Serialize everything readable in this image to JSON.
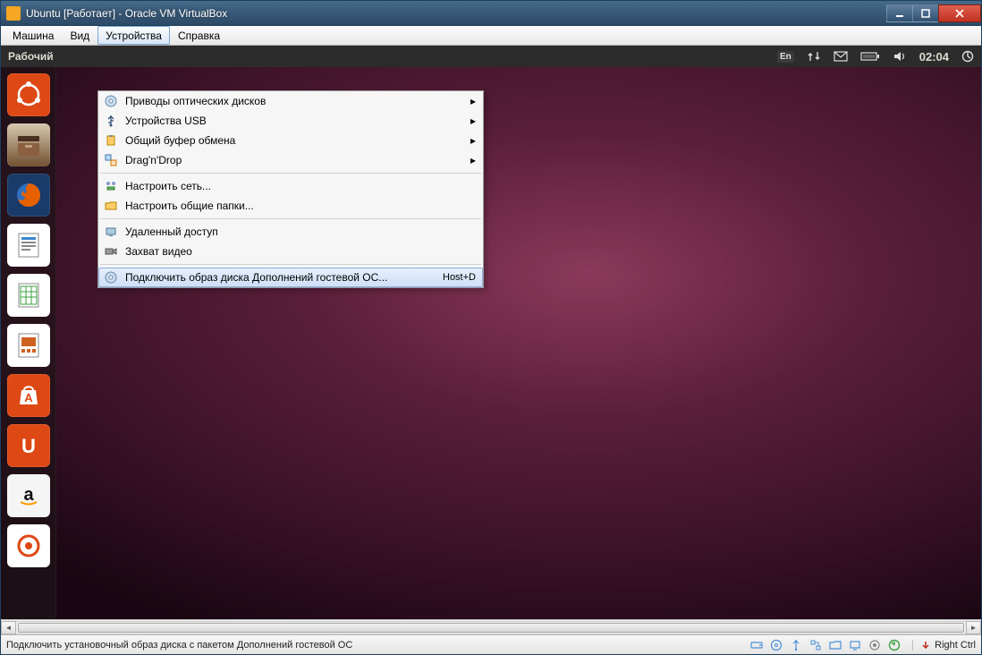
{
  "window": {
    "title": "Ubuntu [Работает] - Oracle VM VirtualBox"
  },
  "vbox_menubar": {
    "items": [
      "Машина",
      "Вид",
      "Устройства",
      "Справка"
    ],
    "active_index": 2
  },
  "dropdown": {
    "groups": [
      [
        {
          "icon": "disc",
          "label": "Приводы оптических дисков",
          "submenu": true
        },
        {
          "icon": "usb",
          "label": "Устройства USB",
          "submenu": true
        },
        {
          "icon": "clipboard",
          "label": "Общий буфер обмена",
          "submenu": true
        },
        {
          "icon": "dragdrop",
          "label": "Drag'n'Drop",
          "submenu": true
        }
      ],
      [
        {
          "icon": "network",
          "label": "Настроить сеть..."
        },
        {
          "icon": "folder",
          "label": "Настроить общие папки..."
        }
      ],
      [
        {
          "icon": "remote",
          "label": "Удаленный доступ"
        },
        {
          "icon": "video",
          "label": "Захват видео"
        }
      ],
      [
        {
          "icon": "guest",
          "label": "Подключить образ диска Дополнений гостевой ОС...",
          "shortcut": "Host+D",
          "highlighted": true
        }
      ]
    ]
  },
  "ubuntu": {
    "topbar_title": "Рабочий",
    "lang_badge": "En",
    "time": "02:04"
  },
  "launcher": {
    "items": [
      {
        "name": "ubuntu-dash",
        "color": "#dd4814",
        "glyph": "circle-friends"
      },
      {
        "name": "files",
        "color": "#b08050",
        "glyph": "drawer"
      },
      {
        "name": "firefox",
        "color": "#e66000",
        "glyph": "firefox"
      },
      {
        "name": "libreoffice-writer",
        "color": "#3a87cf",
        "glyph": "doc"
      },
      {
        "name": "libreoffice-calc",
        "color": "#3ca040",
        "glyph": "sheet"
      },
      {
        "name": "libreoffice-impress",
        "color": "#d06020",
        "glyph": "slides"
      },
      {
        "name": "ubuntu-software",
        "color": "#dd4814",
        "glyph": "bag"
      },
      {
        "name": "ubuntu-one",
        "color": "#dd4814",
        "glyph": "u-one"
      },
      {
        "name": "amazon",
        "color": "#f5f5f5",
        "glyph": "amazon"
      },
      {
        "name": "settings",
        "color": "#dd4814",
        "glyph": "gear-ring"
      }
    ]
  },
  "statusbar": {
    "hint": "Подключить установочный образ диска с пакетом Дополнений гостевой ОС",
    "host_key": "Right Ctrl"
  }
}
